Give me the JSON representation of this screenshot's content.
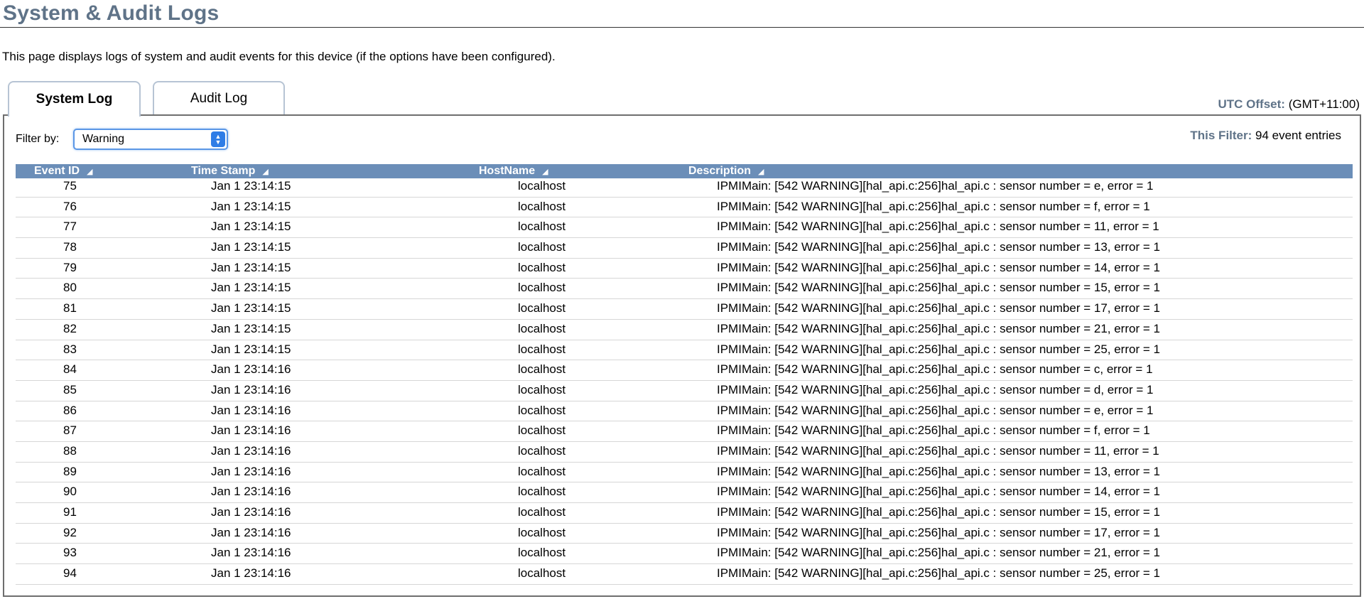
{
  "page": {
    "title": "System & Audit Logs",
    "description": "This page displays logs of system and audit events for this device (if the options have been configured)."
  },
  "tabs": [
    {
      "label": "System Log",
      "active": true
    },
    {
      "label": "Audit Log",
      "active": false
    }
  ],
  "utc": {
    "label": "UTC Offset:",
    "value": " (GMT+11:00)"
  },
  "filter": {
    "label": "Filter by:",
    "selected": "Warning",
    "count_label": "This Filter:",
    "count_value": " 94 event entries"
  },
  "columns": {
    "event_id": "Event ID",
    "timestamp": "Time Stamp",
    "hostname": "HostName",
    "description": "Description"
  },
  "sort_icon": "sort-indicator-icon",
  "colors": {
    "title": "#5f7388",
    "header_bg": "#6b8eb8",
    "select_accent": "#2f7de6"
  },
  "rows": [
    {
      "id": "75",
      "ts": "Jan 1 23:14:15",
      "host": "localhost",
      "desc": "IPMIMain: [542 WARNING][hal_api.c:256]hal_api.c : sensor number = e, error = 1"
    },
    {
      "id": "76",
      "ts": "Jan 1 23:14:15",
      "host": "localhost",
      "desc": "IPMIMain: [542 WARNING][hal_api.c:256]hal_api.c : sensor number = f, error = 1"
    },
    {
      "id": "77",
      "ts": "Jan 1 23:14:15",
      "host": "localhost",
      "desc": "IPMIMain: [542 WARNING][hal_api.c:256]hal_api.c : sensor number = 11, error = 1"
    },
    {
      "id": "78",
      "ts": "Jan 1 23:14:15",
      "host": "localhost",
      "desc": "IPMIMain: [542 WARNING][hal_api.c:256]hal_api.c : sensor number = 13, error = 1"
    },
    {
      "id": "79",
      "ts": "Jan 1 23:14:15",
      "host": "localhost",
      "desc": "IPMIMain: [542 WARNING][hal_api.c:256]hal_api.c : sensor number = 14, error = 1"
    },
    {
      "id": "80",
      "ts": "Jan 1 23:14:15",
      "host": "localhost",
      "desc": "IPMIMain: [542 WARNING][hal_api.c:256]hal_api.c : sensor number = 15, error = 1"
    },
    {
      "id": "81",
      "ts": "Jan 1 23:14:15",
      "host": "localhost",
      "desc": "IPMIMain: [542 WARNING][hal_api.c:256]hal_api.c : sensor number = 17, error = 1"
    },
    {
      "id": "82",
      "ts": "Jan 1 23:14:15",
      "host": "localhost",
      "desc": "IPMIMain: [542 WARNING][hal_api.c:256]hal_api.c : sensor number = 21, error = 1"
    },
    {
      "id": "83",
      "ts": "Jan 1 23:14:15",
      "host": "localhost",
      "desc": "IPMIMain: [542 WARNING][hal_api.c:256]hal_api.c : sensor number = 25, error = 1"
    },
    {
      "id": "84",
      "ts": "Jan 1 23:14:16",
      "host": "localhost",
      "desc": "IPMIMain: [542 WARNING][hal_api.c:256]hal_api.c : sensor number = c, error = 1"
    },
    {
      "id": "85",
      "ts": "Jan 1 23:14:16",
      "host": "localhost",
      "desc": "IPMIMain: [542 WARNING][hal_api.c:256]hal_api.c : sensor number = d, error = 1"
    },
    {
      "id": "86",
      "ts": "Jan 1 23:14:16",
      "host": "localhost",
      "desc": "IPMIMain: [542 WARNING][hal_api.c:256]hal_api.c : sensor number = e, error = 1"
    },
    {
      "id": "87",
      "ts": "Jan 1 23:14:16",
      "host": "localhost",
      "desc": "IPMIMain: [542 WARNING][hal_api.c:256]hal_api.c : sensor number = f, error = 1"
    },
    {
      "id": "88",
      "ts": "Jan 1 23:14:16",
      "host": "localhost",
      "desc": "IPMIMain: [542 WARNING][hal_api.c:256]hal_api.c : sensor number = 11, error = 1"
    },
    {
      "id": "89",
      "ts": "Jan 1 23:14:16",
      "host": "localhost",
      "desc": "IPMIMain: [542 WARNING][hal_api.c:256]hal_api.c : sensor number = 13, error = 1"
    },
    {
      "id": "90",
      "ts": "Jan 1 23:14:16",
      "host": "localhost",
      "desc": "IPMIMain: [542 WARNING][hal_api.c:256]hal_api.c : sensor number = 14, error = 1"
    },
    {
      "id": "91",
      "ts": "Jan 1 23:14:16",
      "host": "localhost",
      "desc": "IPMIMain: [542 WARNING][hal_api.c:256]hal_api.c : sensor number = 15, error = 1"
    },
    {
      "id": "92",
      "ts": "Jan 1 23:14:16",
      "host": "localhost",
      "desc": "IPMIMain: [542 WARNING][hal_api.c:256]hal_api.c : sensor number = 17, error = 1"
    },
    {
      "id": "93",
      "ts": "Jan 1 23:14:16",
      "host": "localhost",
      "desc": "IPMIMain: [542 WARNING][hal_api.c:256]hal_api.c : sensor number = 21, error = 1"
    },
    {
      "id": "94",
      "ts": "Jan 1 23:14:16",
      "host": "localhost",
      "desc": "IPMIMain: [542 WARNING][hal_api.c:256]hal_api.c : sensor number = 25, error = 1"
    }
  ]
}
